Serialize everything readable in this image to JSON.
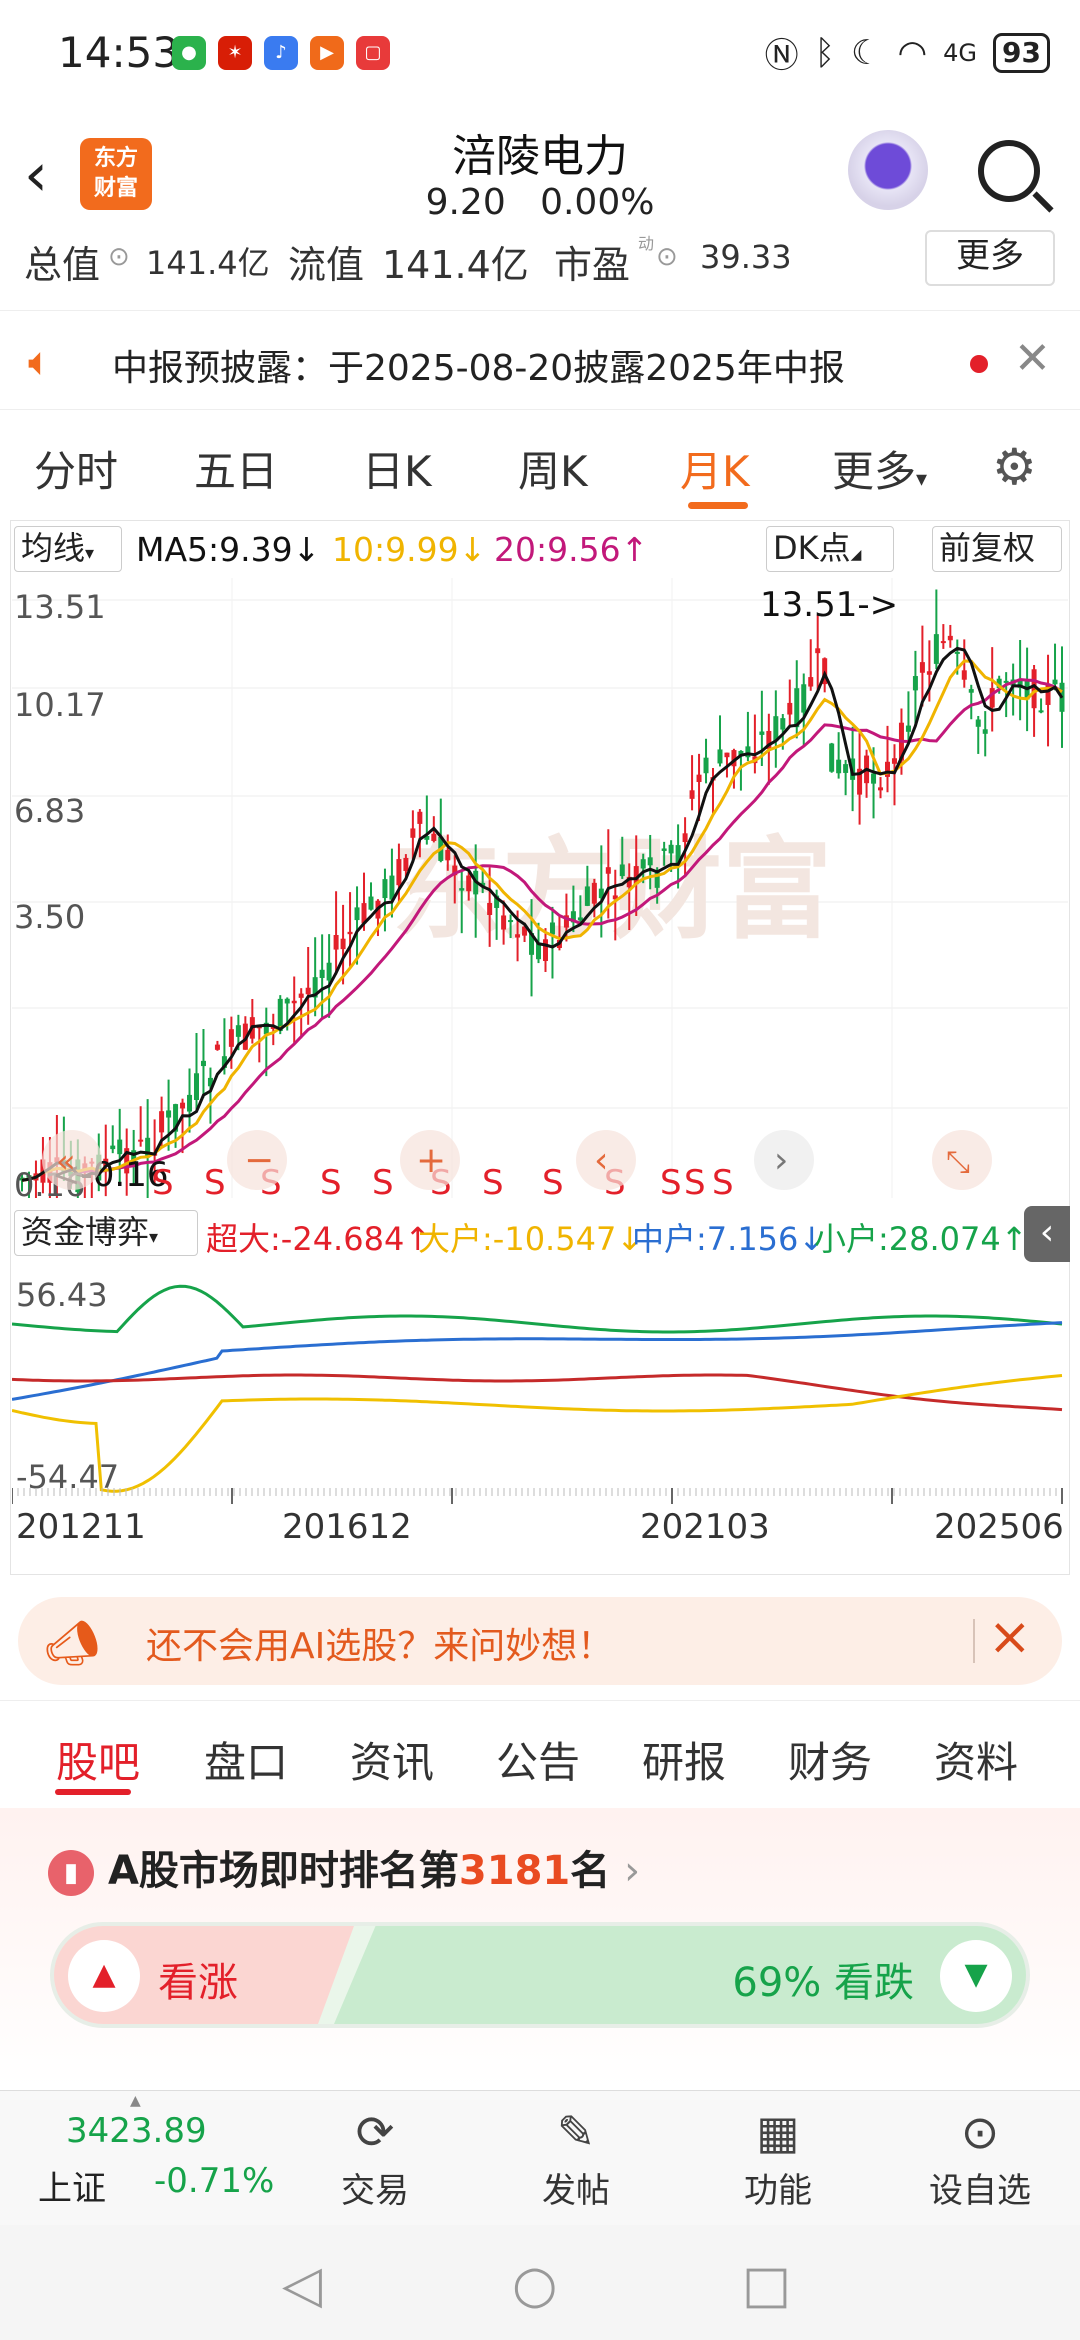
{
  "status": {
    "time": "14:53",
    "battery": "93",
    "signal": "4G"
  },
  "header": {
    "logo_line1": "东方",
    "logo_line2": "财富",
    "title": "涪陵电力",
    "price": "9.20",
    "change": "0.00%"
  },
  "valuation": {
    "total_label": "总值",
    "total_value": "141.4亿",
    "float_label": "流值",
    "float_value": "141.4亿",
    "pe_label": "市盈",
    "pe_sup": "动",
    "pe_value": "39.33",
    "more": "更多"
  },
  "notice": {
    "text": "中报预披露：于2025-08-20披露2025年中报"
  },
  "tabs": [
    "分时",
    "五日",
    "日K",
    "周K",
    "月K",
    "更多"
  ],
  "active_tab": "月K",
  "ma_row": {
    "selector": "均线",
    "ma5": "MA5:9.39",
    "ma10": "10:9.99",
    "ma20": "20:9.56",
    "dk": "DK点",
    "adjust": "前复权"
  },
  "colors": {
    "accent": "#f26b1d",
    "up": "#e3202a",
    "down": "#16a34a",
    "ma5": "#111111",
    "ma10": "#f0b400",
    "ma20": "#c2187a"
  },
  "chart": {
    "y_labels": [
      "13.51",
      "10.17",
      "6.83",
      "3.50",
      "0.16"
    ],
    "high_note": "13.51->",
    "low_note": "<-0.16",
    "signal": "S",
    "x_labels": [
      "201211",
      "201612",
      "202103",
      "202506"
    ]
  },
  "indicator": {
    "selector": "资金博弈",
    "super": "超大:-24.684",
    "big": "大户:-10.547",
    "mid": "中户:7.156",
    "small": "小户:28.074",
    "y_top": "56.43",
    "y_bottom": "-54.47"
  },
  "ad": {
    "text": "还不会用AI选股？来问妙想！"
  },
  "subtabs": [
    "股吧",
    "盘口",
    "资讯",
    "公告",
    "研报",
    "财务",
    "资料"
  ],
  "rank": {
    "prefix": "A股市场即时排名第",
    "number": "3181",
    "suffix": "名"
  },
  "vote": {
    "bull": "看涨",
    "bear": "69% 看跌"
  },
  "bottom": {
    "index_value": "3423.89",
    "index_name": "上证",
    "index_change": "-0.71%",
    "trade": "交易",
    "post": "发帖",
    "func": "功能",
    "watch": "设自选"
  }
}
